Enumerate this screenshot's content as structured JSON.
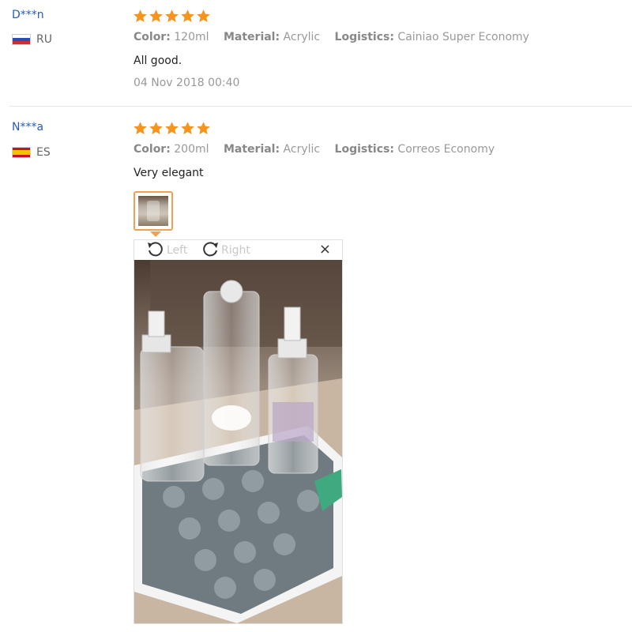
{
  "reviews": [
    {
      "user": "D***n",
      "country": "RU",
      "rating": 5,
      "attributes": [
        {
          "label": "Color:",
          "value": "120ml"
        },
        {
          "label": "Material:",
          "value": "Acrylic"
        },
        {
          "label": "Logistics:",
          "value": "Cainiao Super Economy"
        }
      ],
      "text": "All good.",
      "date": "04 Nov 2018 00:40"
    },
    {
      "user": "N***a",
      "country": "ES",
      "rating": 5,
      "attributes": [
        {
          "label": "Color:",
          "value": "200ml"
        },
        {
          "label": "Material:",
          "value": "Acrylic"
        },
        {
          "label": "Logistics:",
          "value": "Correos Economy"
        }
      ],
      "text": "Very elegant"
    }
  ],
  "viewer": {
    "rotate_left": "Left",
    "rotate_right": "Right",
    "close": "×"
  },
  "colors": {
    "star": "#f7941d",
    "user_link": "#2a5db0",
    "thumb_border": "#f0a050"
  },
  "icons": {
    "star": "star-icon",
    "rotate_left": "rotate-left-icon",
    "rotate_right": "rotate-right-icon",
    "close": "close-icon"
  }
}
